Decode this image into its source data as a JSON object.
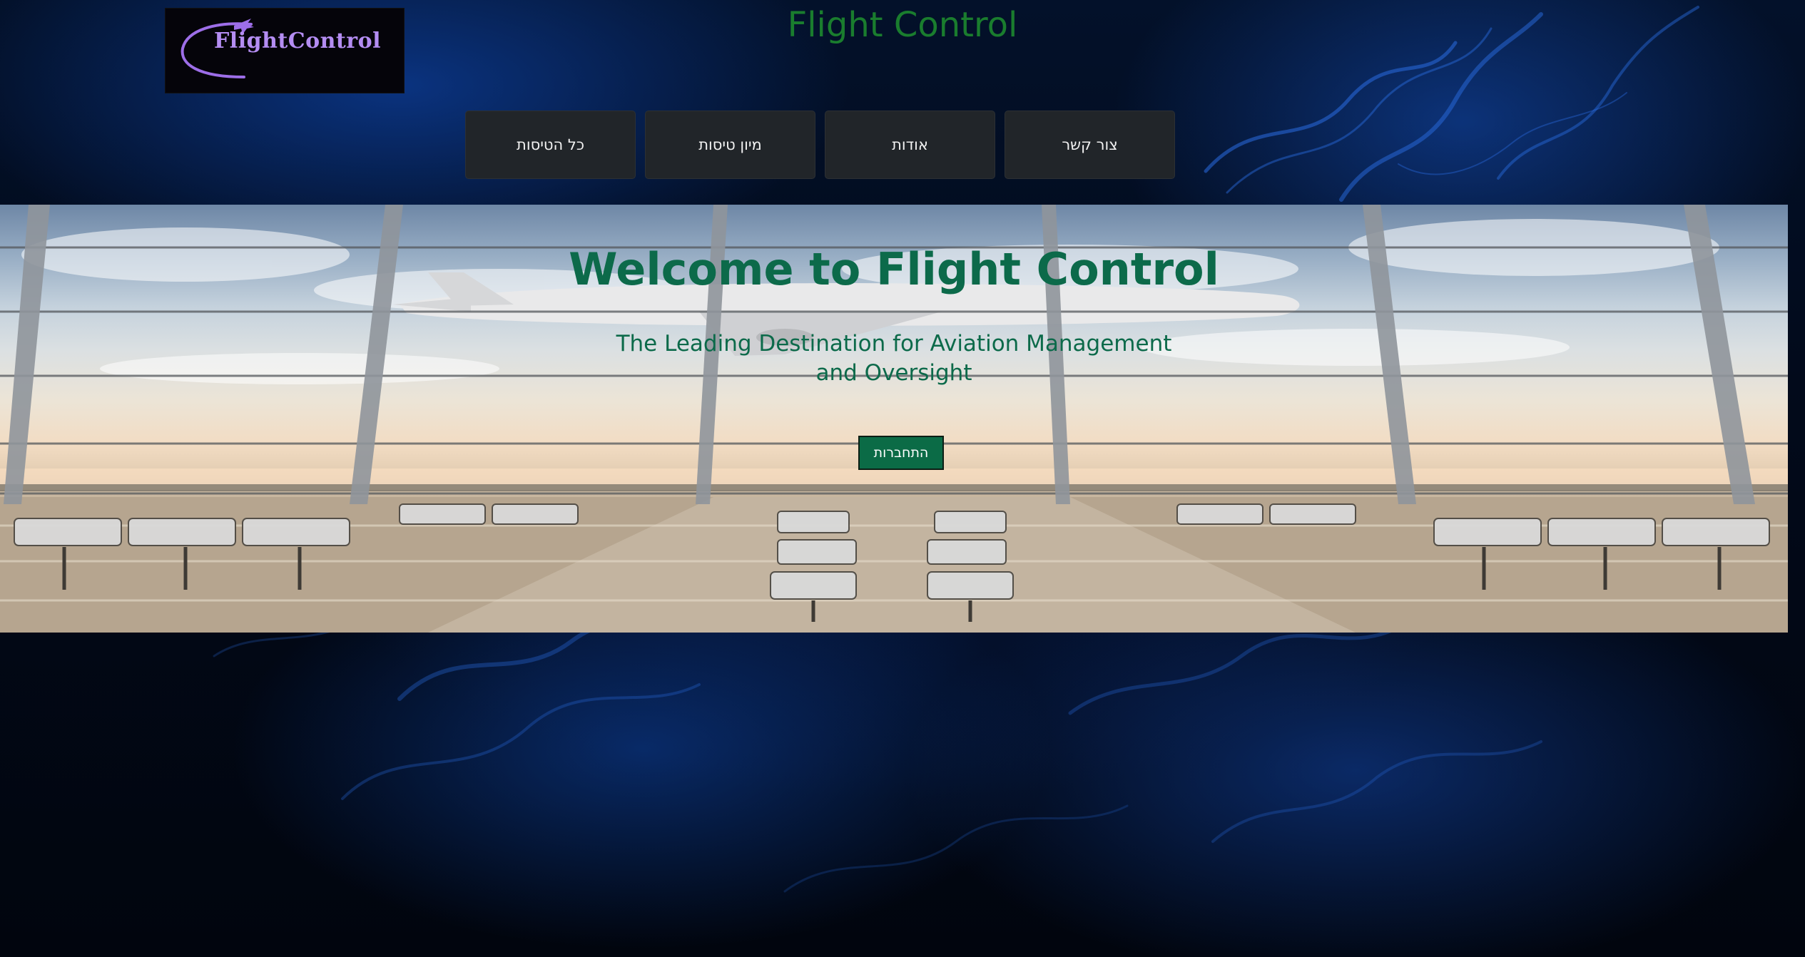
{
  "header": {
    "logo_text": "FlightControl",
    "site_title": "Flight Control"
  },
  "nav": {
    "items": [
      {
        "label": "צור קשר"
      },
      {
        "label": "אודות"
      },
      {
        "label": "מיון טיסות"
      },
      {
        "label": "כל הטיסות"
      }
    ]
  },
  "hero": {
    "title": "Welcome to Flight Control",
    "subtitle": "The Leading Destination for Aviation Management and Oversight",
    "connect_label": "התחברות"
  },
  "colors": {
    "title_green": "#1a7d2e",
    "hero_text_green": "#0c6a4a",
    "button_green": "#0b6b46",
    "nav_dark": "#212529",
    "logo_purple": "#b48df2"
  },
  "icons": {
    "logo_plane": "airplane-icon"
  }
}
